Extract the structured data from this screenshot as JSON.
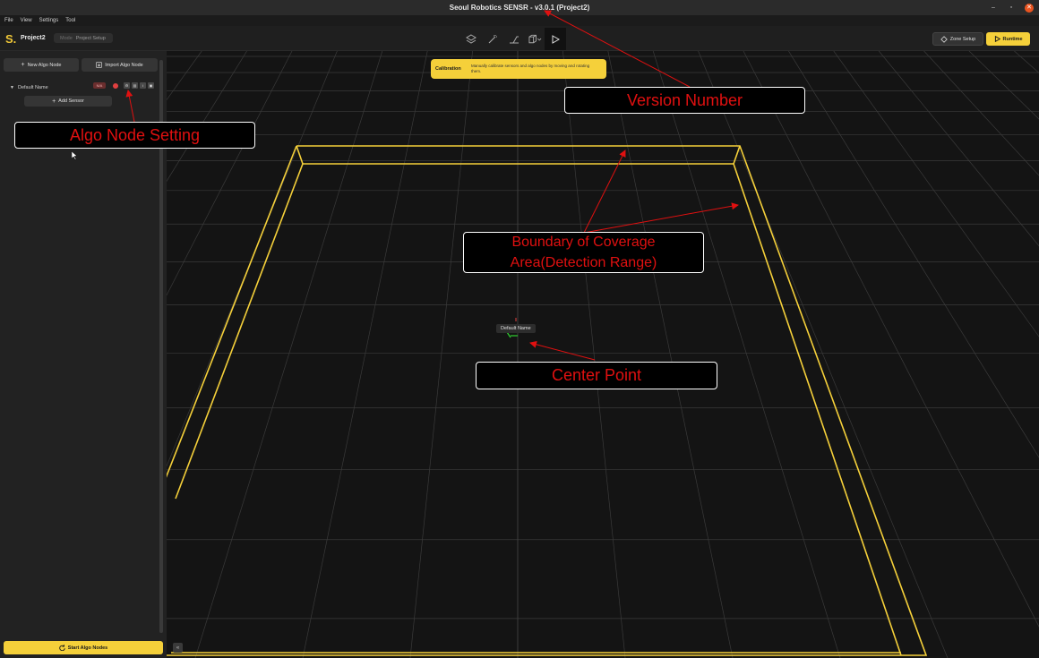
{
  "window": {
    "title": "Seoul Robotics SENSR - v3.0.1 (Project2)",
    "minimize": "–",
    "maximize": "▫",
    "close": "✕"
  },
  "menu": [
    "File",
    "View",
    "Settings",
    "Tool"
  ],
  "appbar": {
    "logo": "S",
    "project": "Project2",
    "mode_label": "Mode",
    "mode_value": "Project Setup",
    "zone_setup": "Zone Setup",
    "runtime": "Runtime"
  },
  "sidebar": {
    "new_algo_node": "New Algo Node",
    "import_algo_node": "Import Algo Node",
    "tree_node": "Default Name",
    "tag": "N/A",
    "add_sensor": "Add Sensor",
    "start_algo_nodes": "Start Algo Nodes",
    "collapse": "«"
  },
  "viewport": {
    "callout_title": "Calibration",
    "callout_text": "Manually calibrate sensors and algo nodes by moving and rotating them.",
    "node_label": "Default Name",
    "colors": {
      "boundary": "#f5d03a",
      "grid": "#3a3a3a",
      "axis_x": "#e04040",
      "axis_y": "#30d030"
    }
  },
  "annotations": {
    "version": "Version Number",
    "algo_setting": "Algo Node Setting",
    "boundary_1": "Boundary of Coverage",
    "boundary_2": "Area(Detection Range)",
    "center": "Center Point"
  }
}
